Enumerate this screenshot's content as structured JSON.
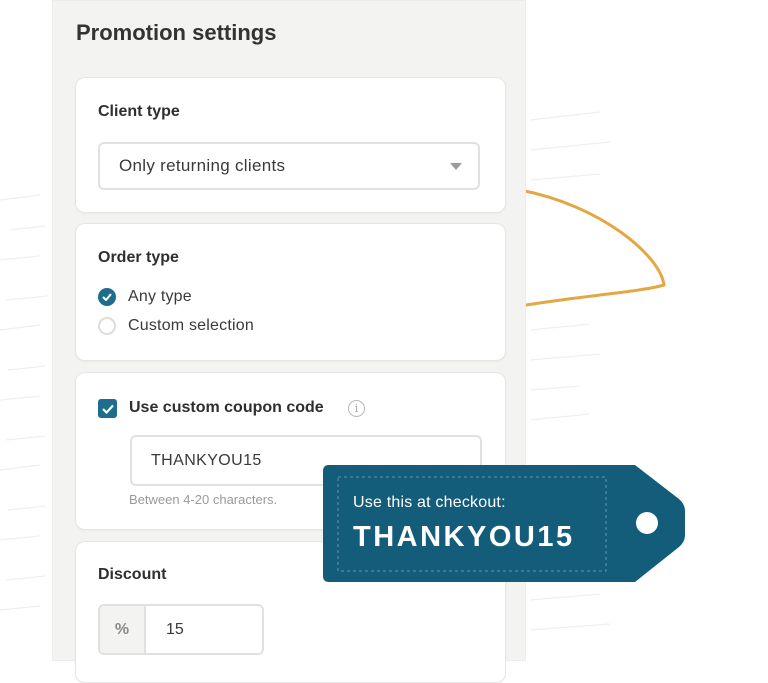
{
  "colors": {
    "accent": "#1f6d8c",
    "tag": "#145d7a",
    "swoosh": "#e5a745",
    "panel_bg": "#f3f3f2"
  },
  "panel": {
    "title": "Promotion settings"
  },
  "client_type": {
    "label": "Client type",
    "selected": "Only returning clients",
    "caret_icon": "chevron-down-icon"
  },
  "order_type": {
    "label": "Order type",
    "options": [
      {
        "label": "Any type",
        "checked": true
      },
      {
        "label": "Custom selection",
        "checked": false
      }
    ]
  },
  "coupon": {
    "checkbox_label": "Use custom coupon code",
    "checked": true,
    "info_icon": "info-icon",
    "value": "THANKYOU15",
    "hint": "Between 4-20 characters."
  },
  "discount": {
    "label": "Discount",
    "unit": "%",
    "value": "15"
  },
  "tag": {
    "caption": "Use this at checkout:",
    "code": "THANKYOU15"
  }
}
